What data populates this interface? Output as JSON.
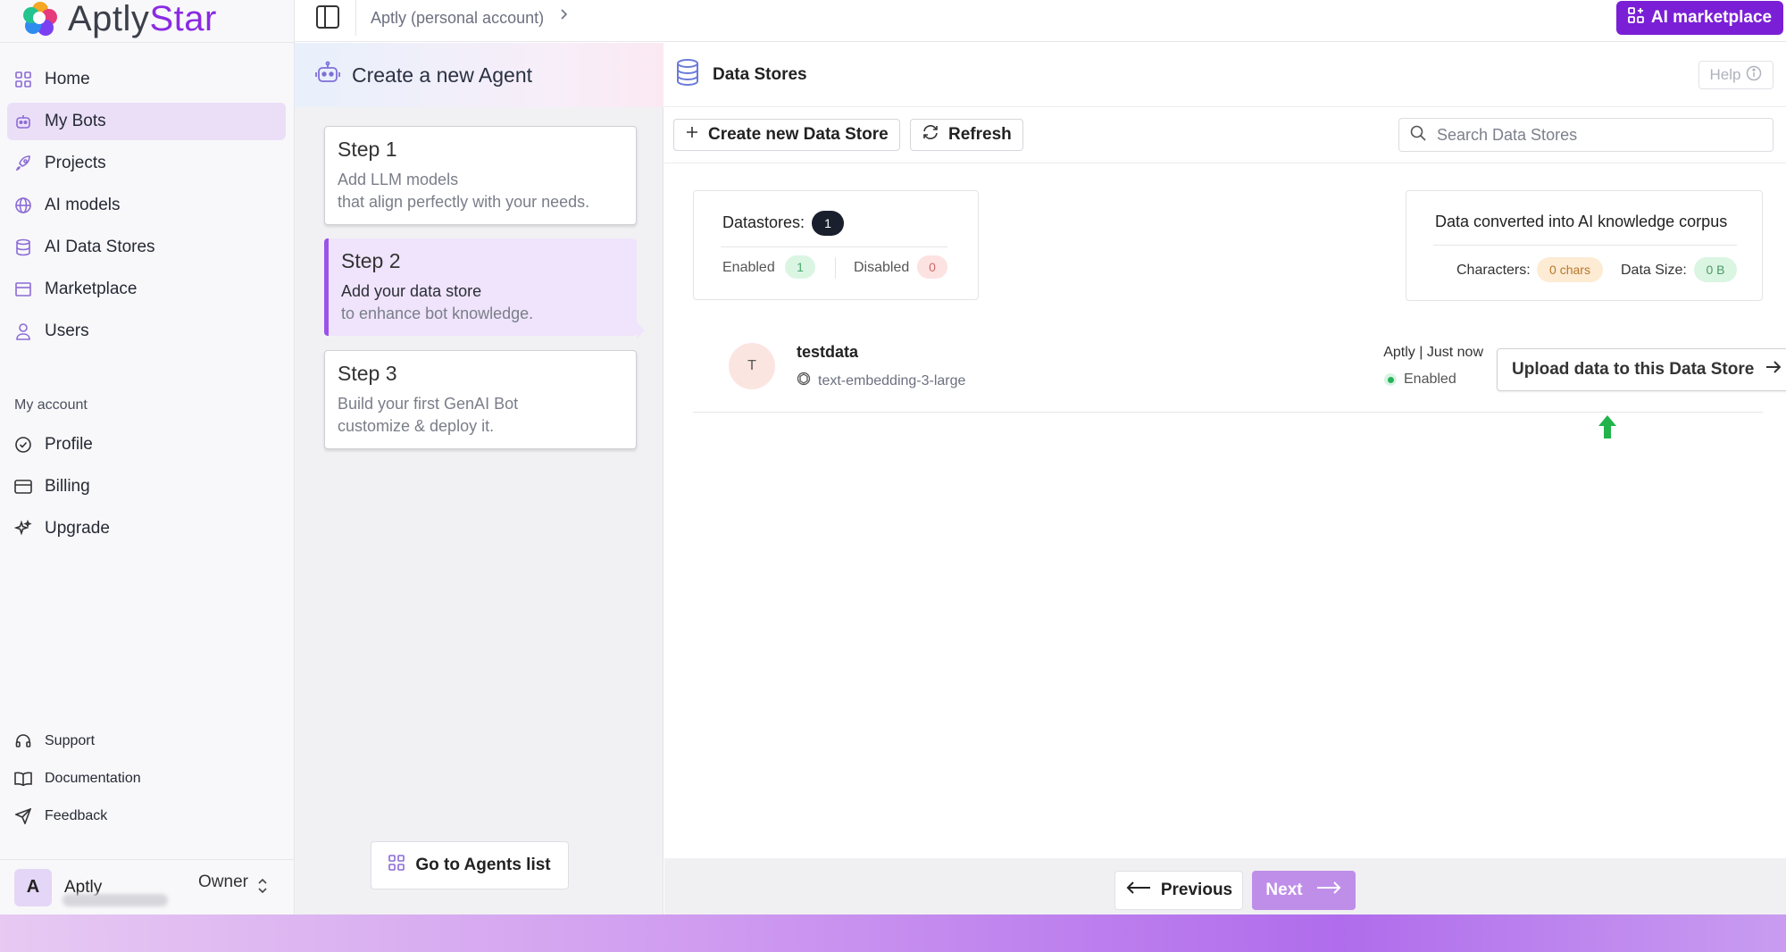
{
  "app": {
    "logo_prefix": "Aptly",
    "logo_suffix": "Star",
    "accent_color": "#7a1fd6"
  },
  "sidebar": {
    "items": [
      {
        "label": "Home",
        "icon": "home-grid-icon"
      },
      {
        "label": "My Bots",
        "icon": "bot-icon",
        "active": true
      },
      {
        "label": "Projects",
        "icon": "rocket-icon"
      },
      {
        "label": "AI models",
        "icon": "globe-network-icon"
      },
      {
        "label": "AI Data Stores",
        "icon": "database-icon"
      },
      {
        "label": "Marketplace",
        "icon": "store-icon"
      },
      {
        "label": "Users",
        "icon": "user-icon"
      }
    ],
    "account_label": "My account",
    "account_items": [
      {
        "label": "Profile",
        "icon": "badge-check-icon"
      },
      {
        "label": "Billing",
        "icon": "credit-card-icon"
      },
      {
        "label": "Upgrade",
        "icon": "sparkles-icon"
      }
    ],
    "footer_items": [
      {
        "label": "Support",
        "icon": "headset-icon"
      },
      {
        "label": "Documentation",
        "icon": "book-open-icon"
      },
      {
        "label": "Feedback",
        "icon": "send-icon"
      }
    ],
    "user": {
      "initial": "A",
      "name": "Aptly",
      "role": "Owner"
    }
  },
  "topbar": {
    "breadcrumb": "Aptly (personal account)",
    "marketplace_button": "AI marketplace"
  },
  "steps": {
    "title": "Create a new Agent",
    "items": [
      {
        "title": "Step 1",
        "line1": "Add LLM models",
        "line2": "that align perfectly with your needs."
      },
      {
        "title": "Step 2",
        "line1": "Add your data store",
        "line2": "to enhance bot knowledge.",
        "active": true
      },
      {
        "title": "Step 3",
        "line1": "Build your first GenAI Bot",
        "line2": "customize & deploy it."
      }
    ],
    "go_agents": "Go to Agents list"
  },
  "main": {
    "title": "Data Stores",
    "help": "Help",
    "create_button": "Create new Data Store",
    "refresh_button": "Refresh",
    "search_placeholder": "Search Data Stores",
    "summary": {
      "datastores_label": "Datastores:",
      "datastores_count": "1",
      "enabled_label": "Enabled",
      "enabled_count": "1",
      "disabled_label": "Disabled",
      "disabled_count": "0"
    },
    "corpus": {
      "title": "Data converted into AI knowledge corpus",
      "characters_label": "Characters:",
      "characters_value": "0 chars",
      "size_label": "Data Size:",
      "size_value": "0 B"
    },
    "stores": [
      {
        "initial": "T",
        "name": "testdata",
        "model": "text-embedding-3-large",
        "meta": "Aptly | Just now",
        "status": "Enabled",
        "upload_button": "Upload data to this Data Store"
      }
    ],
    "footer": {
      "previous": "Previous",
      "next": "Next"
    }
  }
}
